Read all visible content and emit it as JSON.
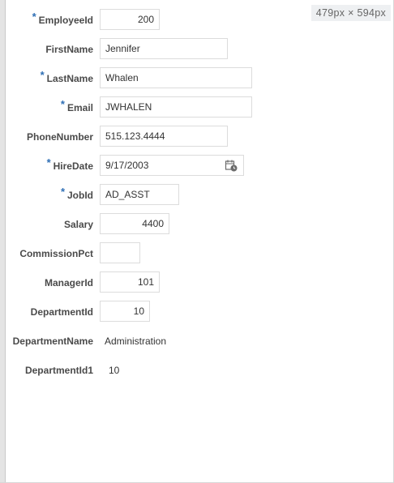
{
  "dimensions_badge": "479px  ×  594px",
  "form": {
    "required_marker": "*",
    "employee_id": {
      "label": "EmployeeId",
      "value": "200"
    },
    "first_name": {
      "label": "FirstName",
      "value": "Jennifer"
    },
    "last_name": {
      "label": "LastName",
      "value": "Whalen"
    },
    "email": {
      "label": "Email",
      "value": "JWHALEN"
    },
    "phone_number": {
      "label": "PhoneNumber",
      "value": "515.123.4444"
    },
    "hire_date": {
      "label": "HireDate",
      "value": "9/17/2003",
      "icon": "calendar-icon"
    },
    "job_id": {
      "label": "JobId",
      "value": "AD_ASST"
    },
    "salary": {
      "label": "Salary",
      "value": "4400"
    },
    "commission_pct": {
      "label": "CommissionPct",
      "value": ""
    },
    "manager_id": {
      "label": "ManagerId",
      "value": "101"
    },
    "department_id": {
      "label": "DepartmentId",
      "value": "10"
    },
    "department_name": {
      "label": "DepartmentName",
      "value": "Administration"
    },
    "department_id1": {
      "label": "DepartmentId1",
      "value": "10"
    }
  }
}
